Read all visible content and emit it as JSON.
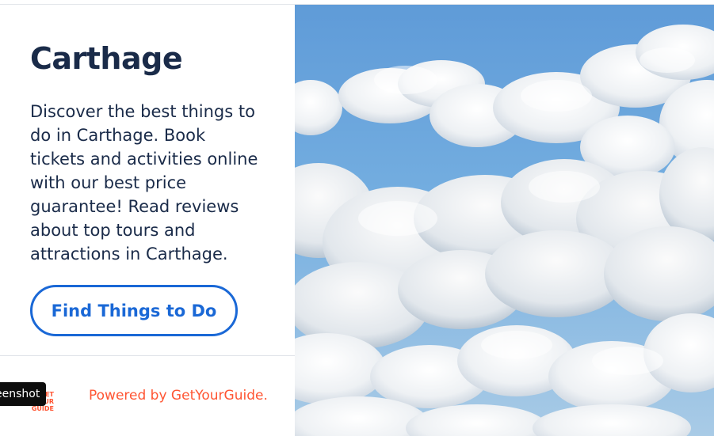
{
  "destination": {
    "title": "Carthage",
    "description": "Discover the best things to do in Carthage. Book tickets and activities online with our best price guarantee! Read reviews about top tours and attractions in Carthage."
  },
  "cta": {
    "label": "Find Things to Do"
  },
  "footer": {
    "logo_lines": [
      "GET",
      "YOUR",
      "GUIDE"
    ],
    "powered_by": "Powered by GetYourGuide.",
    "tooltip": "eenshot"
  },
  "hero": {
    "icon": "cloud-sky-photo",
    "sky_color": "#6aa5dd",
    "cloud_color": "#f6f7f8"
  },
  "colors": {
    "title": "#1a2b49",
    "button_border": "#1a68d6",
    "brand_orange": "#ff5533"
  }
}
